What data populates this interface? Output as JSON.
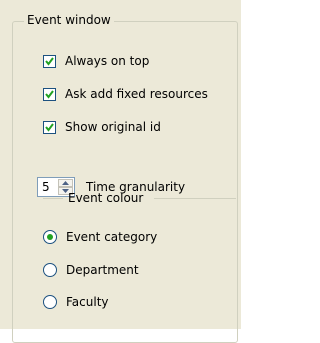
{
  "event_window": {
    "title": "Event window",
    "checkboxes": [
      {
        "label": "Always on top",
        "checked": true
      },
      {
        "label": "Ask add fixed resources",
        "checked": true
      },
      {
        "label": "Show original id",
        "checked": true
      }
    ],
    "time_granularity": {
      "value": "5",
      "label": "Time granularity"
    },
    "event_colour": {
      "title": "Event colour",
      "options": [
        {
          "label": "Event category",
          "selected": true
        },
        {
          "label": "Department",
          "selected": false
        },
        {
          "label": "Faculty",
          "selected": false
        }
      ]
    }
  },
  "colors": {
    "panel": "#ece9d8",
    "border": "#d0d0bf",
    "check": "#21a121",
    "control_border": "#1c5180"
  }
}
